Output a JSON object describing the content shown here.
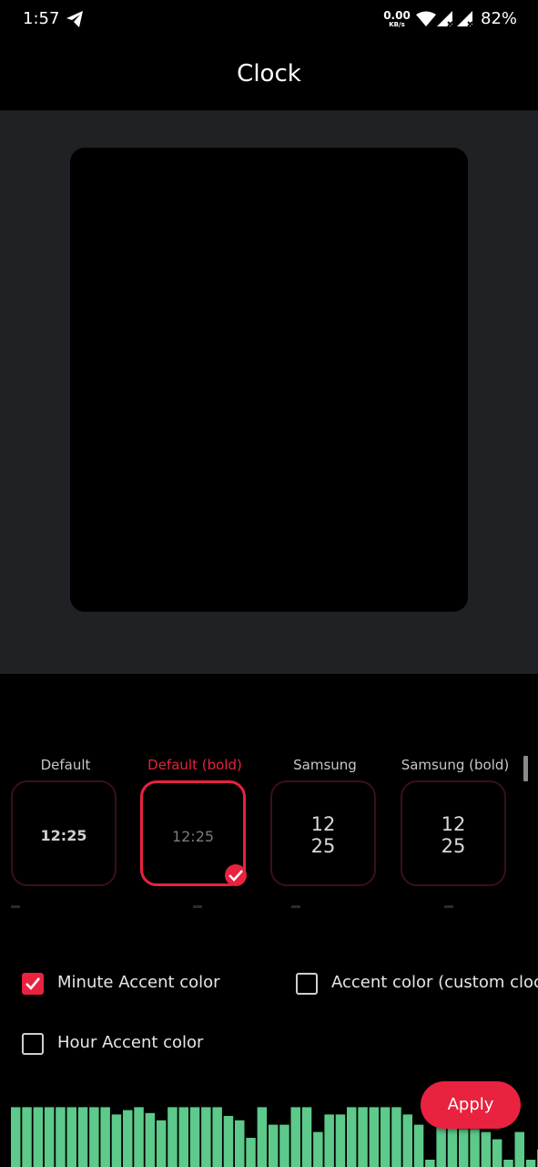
{
  "status_bar": {
    "time": "1:57",
    "net_speed_value": "0.00",
    "net_speed_unit": "KB/s",
    "battery": "82%",
    "icons": [
      "telegram-icon",
      "wifi-icon",
      "signal-icon",
      "signal-icon"
    ]
  },
  "header": {
    "title": "Clock"
  },
  "clock_styles": [
    {
      "label": "Default",
      "preview_text": "12:25",
      "selected": false
    },
    {
      "label": "Default (bold)",
      "preview_text": "12:25",
      "selected": true
    },
    {
      "label": "Samsung",
      "preview_hour": "12",
      "preview_minute": "25",
      "selected": false
    },
    {
      "label": "Samsung (bold)",
      "preview_hour": "12",
      "preview_minute": "25",
      "selected": false
    }
  ],
  "options": {
    "minute_accent": {
      "label": "Minute Accent color",
      "checked": true
    },
    "accent_custom": {
      "label": "Accent color (custom clock)",
      "checked": false
    },
    "hour_accent": {
      "label": "Hour Accent color",
      "checked": false
    }
  },
  "apply_label": "Apply",
  "visualizer_levels": [
    0.82,
    0.82,
    0.82,
    0.82,
    0.82,
    0.82,
    0.82,
    0.82,
    0.82,
    0.72,
    0.78,
    0.82,
    0.74,
    0.64,
    0.82,
    0.82,
    0.82,
    0.82,
    0.82,
    0.7,
    0.64,
    0.4,
    0.82,
    0.58,
    0.58,
    0.82,
    0.82,
    0.48,
    0.72,
    0.72,
    0.82,
    0.82,
    0.82,
    0.82,
    0.82,
    0.72,
    0.58,
    0.1,
    0.68,
    0.82,
    0.52,
    0.52,
    0.48,
    0.38,
    0.1,
    0.48,
    0.1,
    0.24,
    0.48
  ],
  "colors": {
    "accent": "#e8223f",
    "preview_bg": "#202124",
    "visualizer": "#5dc98a",
    "background": "#000000"
  }
}
